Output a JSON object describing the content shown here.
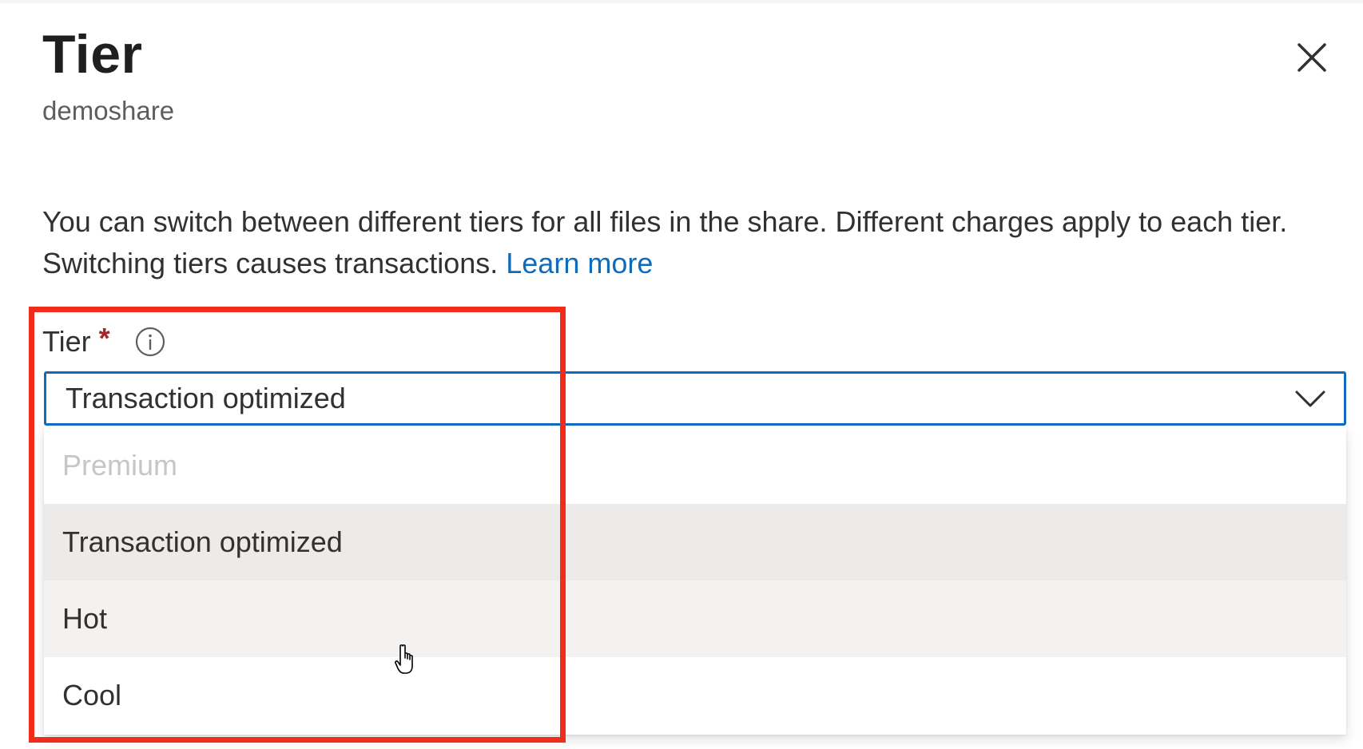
{
  "panel": {
    "title": "Tier",
    "subtitle": "demoshare",
    "close_icon": "close-icon"
  },
  "description": {
    "text": "You can switch between different tiers for all files in the share. Different charges apply to each tier. Switching tiers causes transactions.",
    "link_text": "Learn more"
  },
  "tier_field": {
    "label": "Tier",
    "required_marker": "*",
    "info_icon": "info-icon",
    "selected_value": "Transaction optimized",
    "options": [
      {
        "label": "Premium",
        "state": "disabled"
      },
      {
        "label": "Transaction optimized",
        "state": "selected"
      },
      {
        "label": "Hot",
        "state": "hovered"
      },
      {
        "label": "Cool",
        "state": "normal"
      }
    ]
  },
  "colors": {
    "accent": "#0f6cbd",
    "required": "#a4262c",
    "annotation_box": "#f22c1a",
    "disabled_text": "#c8c6c4",
    "selected_bg": "#edebe9",
    "hover_bg": "#f3f2f1"
  }
}
